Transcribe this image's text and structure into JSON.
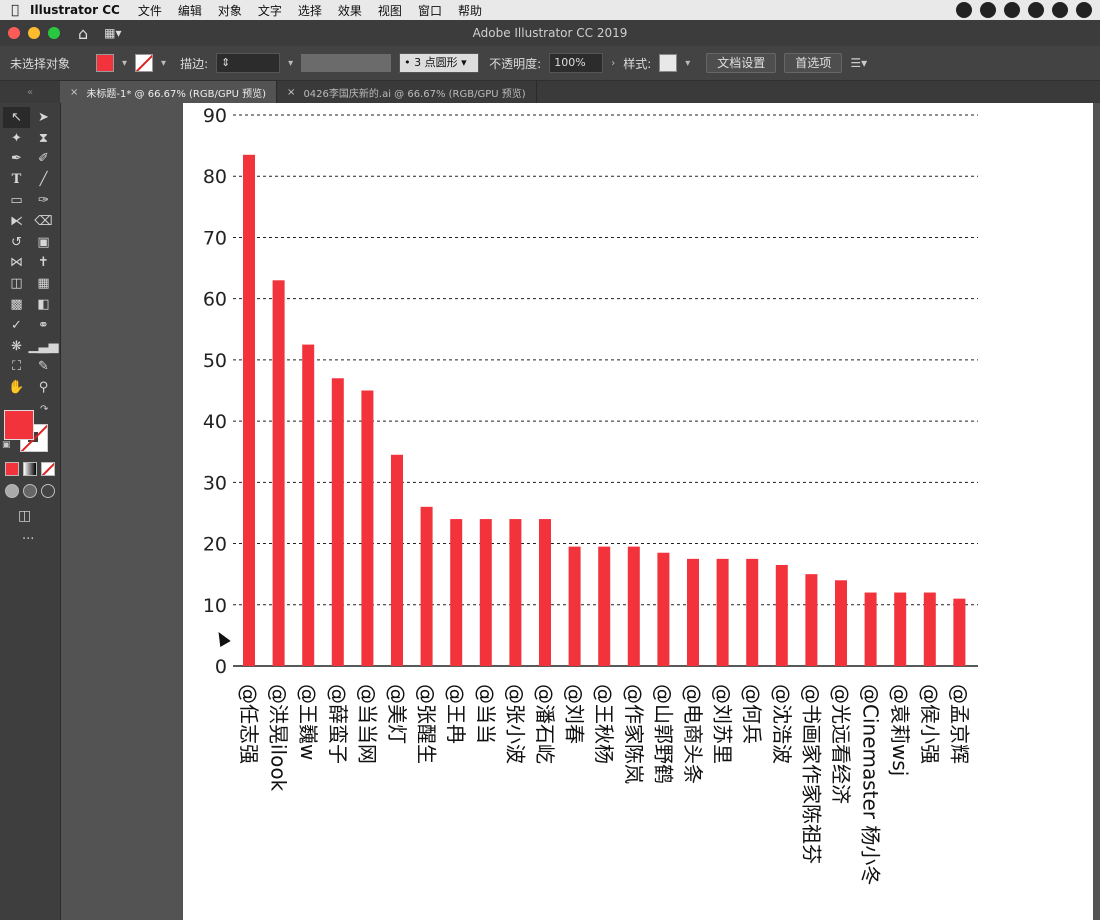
{
  "menubar": {
    "app_name": "Illustrator CC",
    "items": [
      "文件",
      "编辑",
      "对象",
      "文字",
      "选择",
      "效果",
      "视图",
      "窗口",
      "帮助"
    ]
  },
  "window": {
    "title": "Adobe Illustrator CC 2019"
  },
  "control_bar": {
    "selection_label": "未选择对象",
    "stroke_label": "描边:",
    "brush_label": "3 点圆形",
    "opacity_label": "不透明度:",
    "opacity_value": "100%",
    "style_label": "样式:",
    "doc_setup_label": "文档设置",
    "preferences_label": "首选项"
  },
  "tabs": [
    {
      "label": "未标题-1* @ 66.67% (RGB/GPU 预览)",
      "active": true
    },
    {
      "label": "0426李国庆新的.ai @ 66.67% (RGB/GPU 预览)",
      "active": false
    }
  ],
  "colors": {
    "bar": "#f3333c",
    "fill": "#f3333c"
  },
  "toolbar": {
    "more_label": "···"
  },
  "chart_data": {
    "type": "bar",
    "categories": [
      "@任志强",
      "@洪晃ilook",
      "@王巍w",
      "@薛蛮子",
      "@当当网",
      "@美灯",
      "@张醒生",
      "@王冉",
      "@当当",
      "@张小波",
      "@潘石屹",
      "@刘春",
      "@王秋杨",
      "@作家陈岚",
      "@山郭野鹤",
      "@电商头条",
      "@刘苏里",
      "@何兵",
      "@沈浩波",
      "@书画家作家陈祖芬",
      "@光远看经济",
      "@Cinemaster 杨小冬",
      "@袁莉wsj",
      "@侯小强",
      "@孟京辉"
    ],
    "values": [
      83.5,
      63,
      52.5,
      47,
      45,
      34.5,
      26,
      24,
      24,
      24,
      24,
      19.5,
      19.5,
      19.5,
      18.5,
      17.5,
      17.5,
      17.5,
      16.5,
      15,
      14,
      12,
      12,
      12,
      11
    ],
    "yticks": [
      0,
      10,
      20,
      30,
      40,
      50,
      60,
      70,
      80,
      90
    ],
    "ylim": [
      0,
      90
    ],
    "grid": true
  }
}
